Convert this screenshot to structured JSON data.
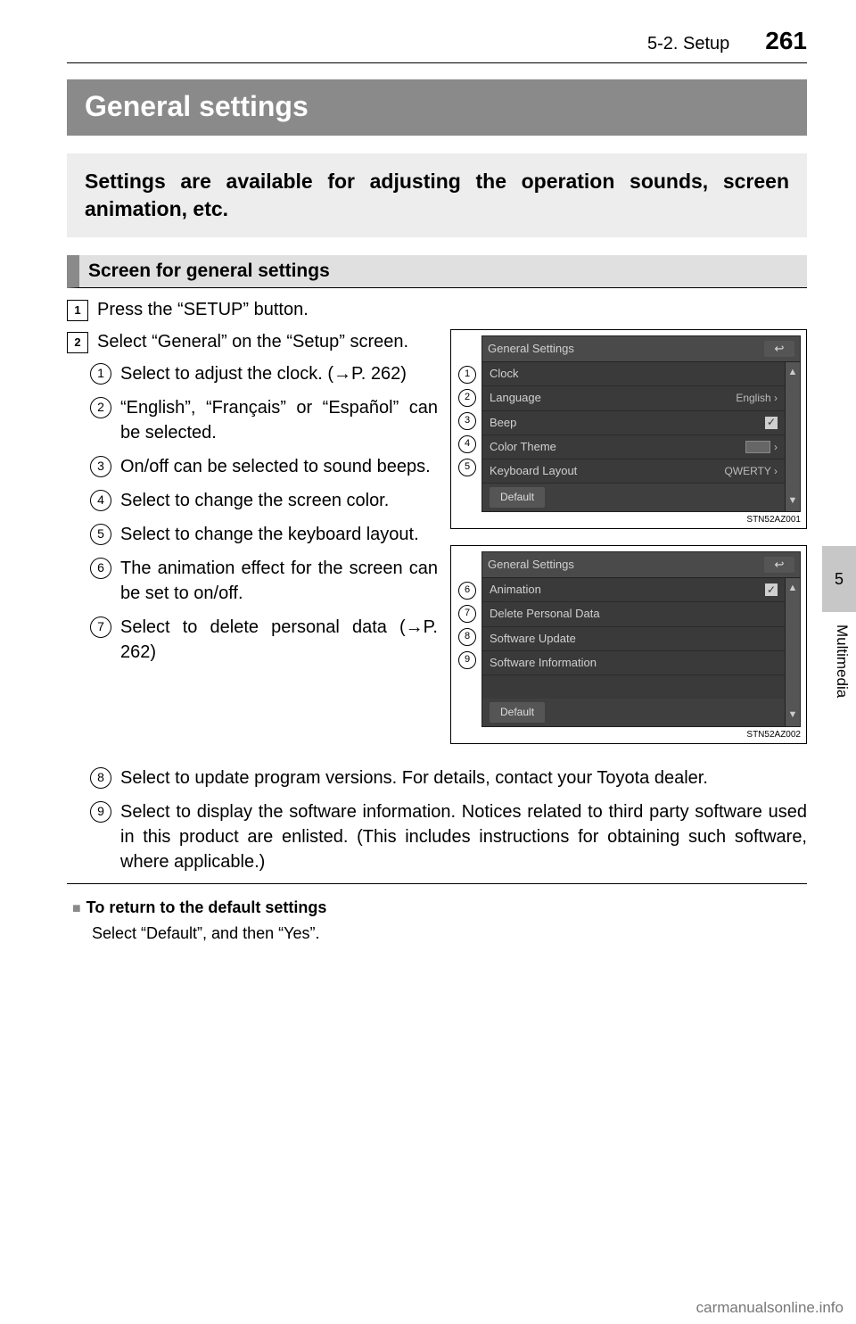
{
  "header": {
    "breadcrumb": "5-2. Setup",
    "page": "261"
  },
  "title": "General settings",
  "intro": "Settings are available for adjusting the operation sounds, screen animation, etc.",
  "section": "Screen for general settings",
  "steps": {
    "s1": "Press the “SETUP” button.",
    "s2": "Select “General” on the “Setup” screen."
  },
  "subs": {
    "i1": "Select to adjust the clock. (→P. 262)",
    "i2": "“English”, “Français” or “Español” can be selected.",
    "i3": "On/off can be selected to sound beeps.",
    "i4": "Select to change the screen color.",
    "i5": "Select to change the keyboard layout.",
    "i6": "The animation effect for the screen can be set to on/off.",
    "i7": "Select to delete personal data (→P. 262)",
    "i8": "Select to update program versions. For details, contact your Toyota dealer.",
    "i9": "Select to display the software information. Notices related to third party software used in this product are enlisted. (This includes instructions for obtaining such software, where applicable.)"
  },
  "fig1": {
    "title": "General Settings",
    "rows": {
      "r1": {
        "label": "Clock",
        "val": ""
      },
      "r2": {
        "label": "Language",
        "val": "English ›"
      },
      "r3": {
        "label": "Beep",
        "val": ""
      },
      "r4": {
        "label": "Color Theme",
        "val": "›"
      },
      "r5": {
        "label": "Keyboard Layout",
        "val": "QWERTY ›"
      }
    },
    "default": "Default",
    "caption": "STN52AZ001"
  },
  "fig2": {
    "title": "General Settings",
    "rows": {
      "r6": {
        "label": "Animation",
        "val": ""
      },
      "r7": {
        "label": "Delete Personal Data",
        "val": ""
      },
      "r8": {
        "label": "Software Update",
        "val": ""
      },
      "r9": {
        "label": "Software Information",
        "val": ""
      }
    },
    "default": "Default",
    "caption": "STN52AZ002"
  },
  "note": {
    "head": "To return to the default settings",
    "body": "Select “Default”, and then “Yes”."
  },
  "side": {
    "chapter": "5",
    "label": "Multimedia"
  },
  "watermark": "carmanualsonline.info"
}
